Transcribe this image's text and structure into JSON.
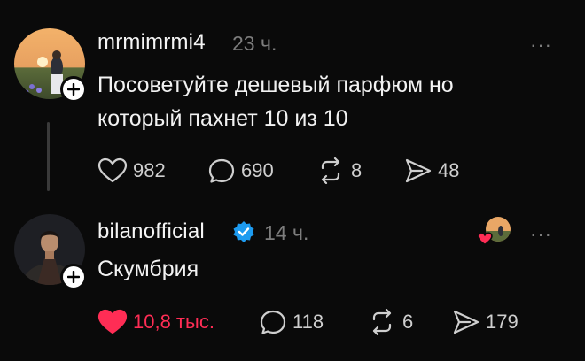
{
  "posts": [
    {
      "username": "mrmimrmi4",
      "time": "23 ч.",
      "text_lines": [
        "Посоветуйте дешевый парфюм но",
        "который пахнет 10 из 10"
      ],
      "verified": false,
      "more_icon": "ellipsis-icon",
      "actions": {
        "likes": "982",
        "replies": "690",
        "reposts": "8",
        "shares": "48"
      },
      "liked": false
    },
    {
      "username": "bilanofficial",
      "time": "14 ч.",
      "text_lines": [
        "Скумбрия"
      ],
      "verified": true,
      "more_icon": "ellipsis-icon",
      "actions": {
        "likes": "10,8 тыс.",
        "replies": "118",
        "reposts": "6",
        "shares": "179"
      },
      "liked": true
    }
  ],
  "colors": {
    "background": "#0a0a0a",
    "muted": "#7d7d7d",
    "like_active": "#ff2d55",
    "verified": "#1d9bf0"
  },
  "more_label": "···"
}
